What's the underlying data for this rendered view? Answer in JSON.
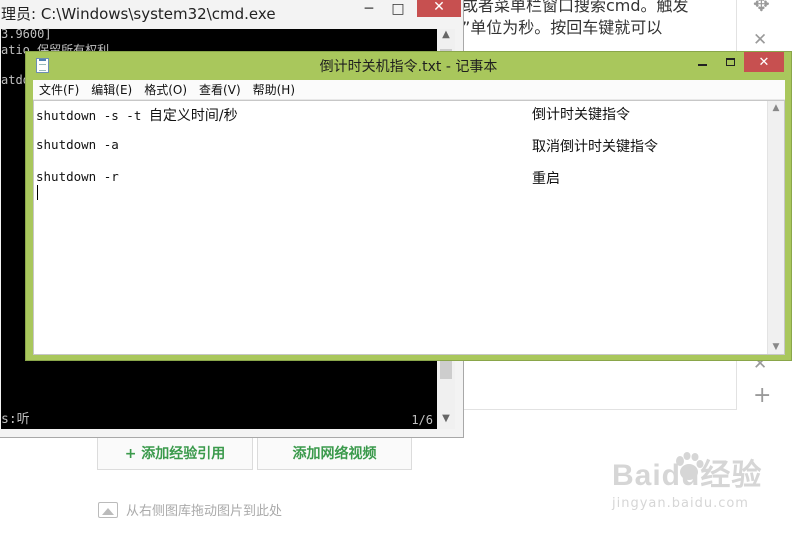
{
  "background": {
    "article_line1": "或者菜单栏窗口搜索cmd。触发",
    "article_line2": "”单位为秒。按回车键就可以",
    "buttons": {
      "add_experience": "+ 添加经验引用",
      "add_video": "添加网络视频"
    },
    "drag_hint": "从右侧图库拖动图片到此处",
    "watermark_logo": "Baidu经验",
    "watermark_url": "jingyan.baidu.com"
  },
  "cmd": {
    "title": "理员: C:\\Windows\\system32\\cmd.exe",
    "lines": [
      "3.9600]",
      "atio  保留所有权利",
      "atdo"
    ],
    "status": "s:听",
    "page": "1/6",
    "controls": {
      "minimize": "─",
      "maximize": "□",
      "close": "✕"
    }
  },
  "notepad": {
    "title": "倒计时关机指令.txt - 记事本",
    "menu": [
      "文件(F)",
      "编辑(E)",
      "格式(O)",
      "查看(V)",
      "帮助(H)"
    ],
    "lines": [
      {
        "command": "shutdown -s -t ",
        "command_cn": "自定义时间/秒",
        "comment": "倒计时关键指令"
      },
      {
        "command": "shutdown -a",
        "command_cn": "",
        "comment": "取消倒计时关键指令"
      },
      {
        "command": "shutdown -r",
        "command_cn": "",
        "comment": "重启"
      }
    ],
    "controls": {
      "close": "✕"
    }
  },
  "side_icons": {
    "move": "✥",
    "close": "✕",
    "add": "+"
  },
  "colors": {
    "notepad_frame": "#a9c75c",
    "close_button": "#c75050",
    "console_bg": "#000000",
    "button_text": "#3b9a4c"
  }
}
